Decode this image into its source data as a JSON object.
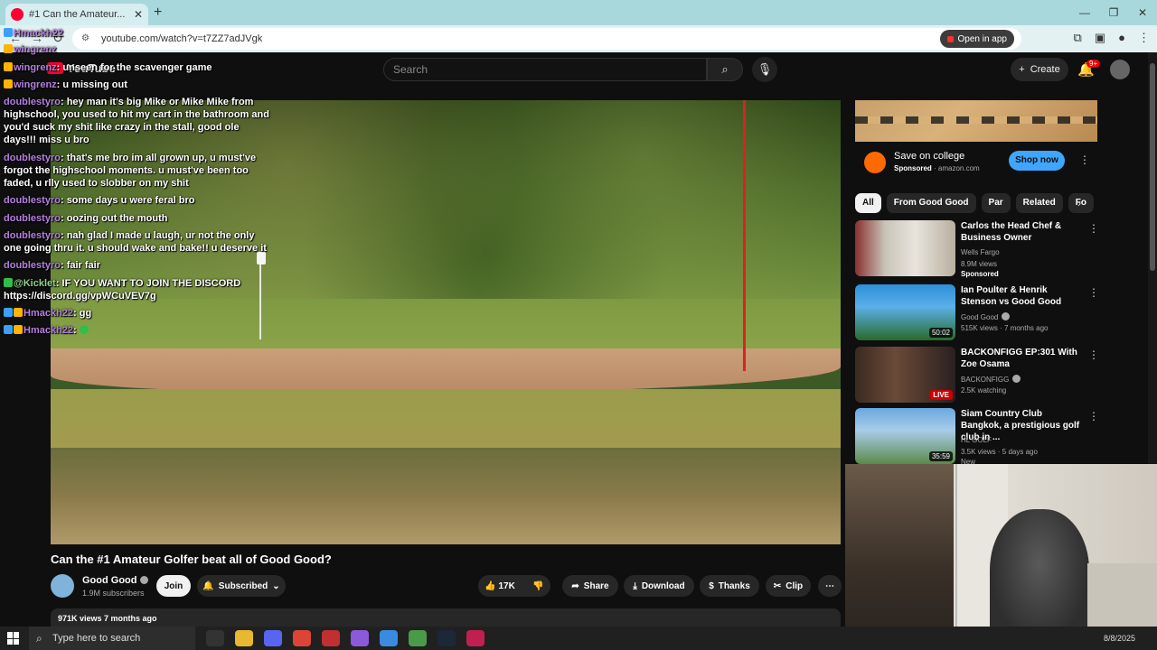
{
  "browser": {
    "tab_title": "#1 Can the Amateur...",
    "url": "youtube.com/watch?v=t7ZZ7adJVgk",
    "open_in_app": "Open in app"
  },
  "header": {
    "logo": "YouTube",
    "search_placeholder": "Search",
    "create_label": "Create",
    "notif_count": "9+"
  },
  "chat": [
    {
      "user": "Hmackh22",
      "text": "",
      "color": "purple"
    },
    {
      "user": "wingrenz",
      "text": "",
      "color": "purple"
    },
    {
      "user": "wingrenz",
      "text": "unseen for the scavenger game",
      "color": "purple"
    },
    {
      "user": "wingrenz",
      "text": "u missing out",
      "color": "purple"
    },
    {
      "user": "doublestyro",
      "text": "hey man it's big Mike or Mike Mike from highschool, you used to hit my cart in the bathroom and you'd suck my shit like crazy in the stall, good ole days!!! miss u bro",
      "color": "purple"
    },
    {
      "user": "doublestyro",
      "text": "that's me bro im all grown up, u must've forgot the highschool moments. u must've been too faded, u rlly used to slobber on my shit",
      "color": "purple"
    },
    {
      "user": "doublestyro",
      "text": "some days u were feral bro",
      "color": "purple"
    },
    {
      "user": "doublestyro",
      "text": "oozing out the mouth",
      "color": "purple"
    },
    {
      "user": "doublestyro",
      "text": "nah glad I made u laugh, ur not the only one going thru it. u should wake and bake!! u deserve it",
      "color": "purple"
    },
    {
      "user": "doublestyro",
      "text": "fair fair",
      "color": "purple"
    },
    {
      "user": "@Kicklet",
      "text": "IF YOU WANT TO JOIN THE DISCORD https://discord.gg/vpWCuVEV7g",
      "color": "green"
    },
    {
      "user": "Hmackh22",
      "text": "gg",
      "color": "purple"
    },
    {
      "user": "Hmackh22",
      "text": "",
      "color": "purple"
    }
  ],
  "video": {
    "title": "Can the #1 Amateur Golfer beat all of Good Good?",
    "channel": "Good Good",
    "subscribers": "1.9M subscribers",
    "join": "Join",
    "subscribed": "Subscribed",
    "likes": "17K",
    "share": "Share",
    "download": "Download",
    "thanks": "Thanks",
    "clip": "Clip",
    "views_date": "971K views  7 months ago"
  },
  "ad": {
    "title": "Save on college",
    "sponsored": "Sponsored",
    "domain": "· amazon.com",
    "cta": "Shop now"
  },
  "chips": [
    "All",
    "From Good Good",
    "Par",
    "Related",
    "Fo"
  ],
  "recommendations": [
    {
      "title": "Carlos the Head Chef & Business Owner",
      "channel": "Wells Fargo",
      "meta": "8.9M views",
      "extra": "Sponsored",
      "badge": ""
    },
    {
      "title": "Ian Poulter & Henrik Stenson vs Good Good",
      "channel": "Good Good",
      "meta": "515K views · 7 months ago",
      "extra": "",
      "badge": "50:02"
    },
    {
      "title": "BACKONFIGG EP:301 With Zoe Osama",
      "channel": "BACKONFIGG",
      "meta": "2.5K watching",
      "extra": "",
      "badge": "LIVE"
    },
    {
      "title": "Siam Country Club Bangkok, a prestigious golf club in ...",
      "channel": "HL GOLF",
      "meta": "3.5K views · 5 days ago",
      "extra": "New",
      "badge": "35:59"
    }
  ],
  "taskbar": {
    "search_placeholder": "Type here to search",
    "date": "8/8/2025"
  }
}
